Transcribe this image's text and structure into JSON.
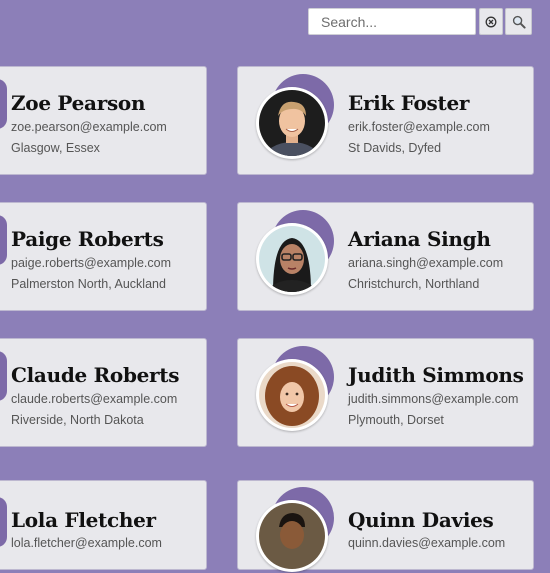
{
  "search": {
    "placeholder": "Search..."
  },
  "icons": {
    "clear": "clear-circle-x-icon",
    "search": "magnifier-icon"
  },
  "colors": {
    "background": "#8c7fb8",
    "accent": "#7d6aa8",
    "card": "#e8e8ec"
  },
  "cards": [
    {
      "name": "Zoe Pearson",
      "email": "zoe.pearson@example.com",
      "location": "Glasgow, Essex"
    },
    {
      "name": "Erik Foster",
      "email": "erik.foster@example.com",
      "location": "St Davids, Dyfed"
    },
    {
      "name": "Paige Roberts",
      "email": "paige.roberts@example.com",
      "location": "Palmerston North, Auckland"
    },
    {
      "name": "Ariana Singh",
      "email": "ariana.singh@example.com",
      "location": "Christchurch, Northland"
    },
    {
      "name": "Claude Roberts",
      "email": "claude.roberts@example.com",
      "location": "Riverside, North Dakota"
    },
    {
      "name": "Judith Simmons",
      "email": "judith.simmons@example.com",
      "location": "Plymouth, Dorset"
    },
    {
      "name": "Lola Fletcher",
      "email": "lola.fletcher@example.com",
      "location": ""
    },
    {
      "name": "Quinn Davies",
      "email": "quinn.davies@example.com",
      "location": ""
    }
  ]
}
